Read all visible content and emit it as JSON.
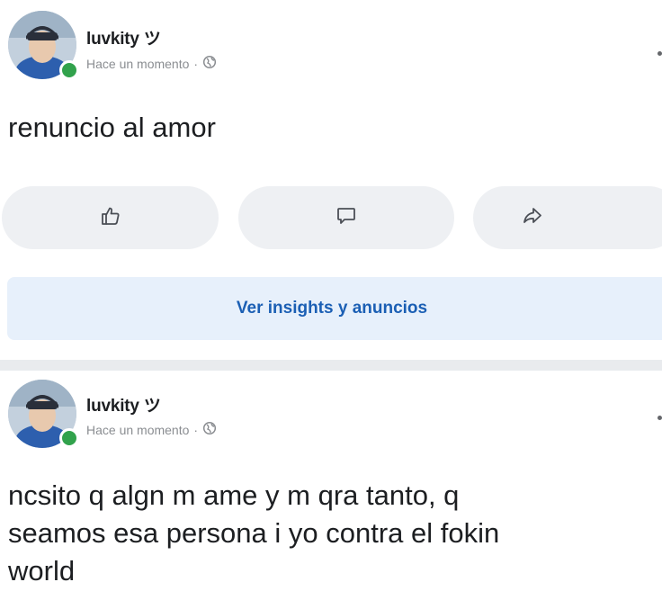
{
  "posts": [
    {
      "author": "luvkity ツ",
      "time": "Hace un momento",
      "separator": "·",
      "text": "renuncio al amor",
      "actions": {
        "like_icon": "thumbs-up-icon",
        "comment_icon": "comment-icon",
        "share_icon": "share-icon"
      },
      "insights_label": "Ver insights y anuncios"
    },
    {
      "author": "luvkity ツ",
      "time": "Hace un momento",
      "separator": "·",
      "text": "ncsito q algn m ame y m qra tanto, q\nseamos esa persona i yo contra el fokin\nworld"
    }
  ],
  "colors": {
    "online": "#31a24c",
    "link": "#1b5fb4",
    "button_bg": "#eef0f3",
    "insights_bg": "#e7f0fb",
    "meta": "#8a8d91"
  }
}
